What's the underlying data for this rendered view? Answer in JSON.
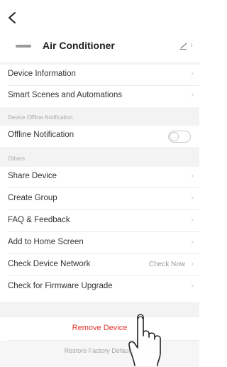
{
  "header": {
    "back_icon": "chevron-left-icon",
    "device_icon": "air-conditioner-icon",
    "device_name": "Air Conditioner",
    "edit_icon": "pencil-icon",
    "edit_chevron": "›"
  },
  "rows": {
    "device_information": "Device Information",
    "smart_scenes": "Smart Scenes and Automations",
    "offline_notification": "Offline Notification",
    "share_device": "Share Device",
    "create_group": "Create Group",
    "faq_feedback": "FAQ & Feedback",
    "add_home_screen": "Add to Home Screen",
    "check_network": "Check Device Network",
    "check_network_value": "Check Now",
    "firmware_upgrade": "Check for Firmware Upgrade",
    "chevron": "›"
  },
  "sections": {
    "offline_section": "Device Offline Notification",
    "others_section": "Others"
  },
  "toggles": {
    "offline_notification_on": false
  },
  "footer": {
    "remove_device": "Remove Device",
    "restore_factory": "Restore Factory Defaults"
  },
  "overlay": {
    "hand_icon": "pointing-hand-icon"
  },
  "colors": {
    "danger": "#e0352b",
    "section_bg": "#f3f3f3"
  }
}
